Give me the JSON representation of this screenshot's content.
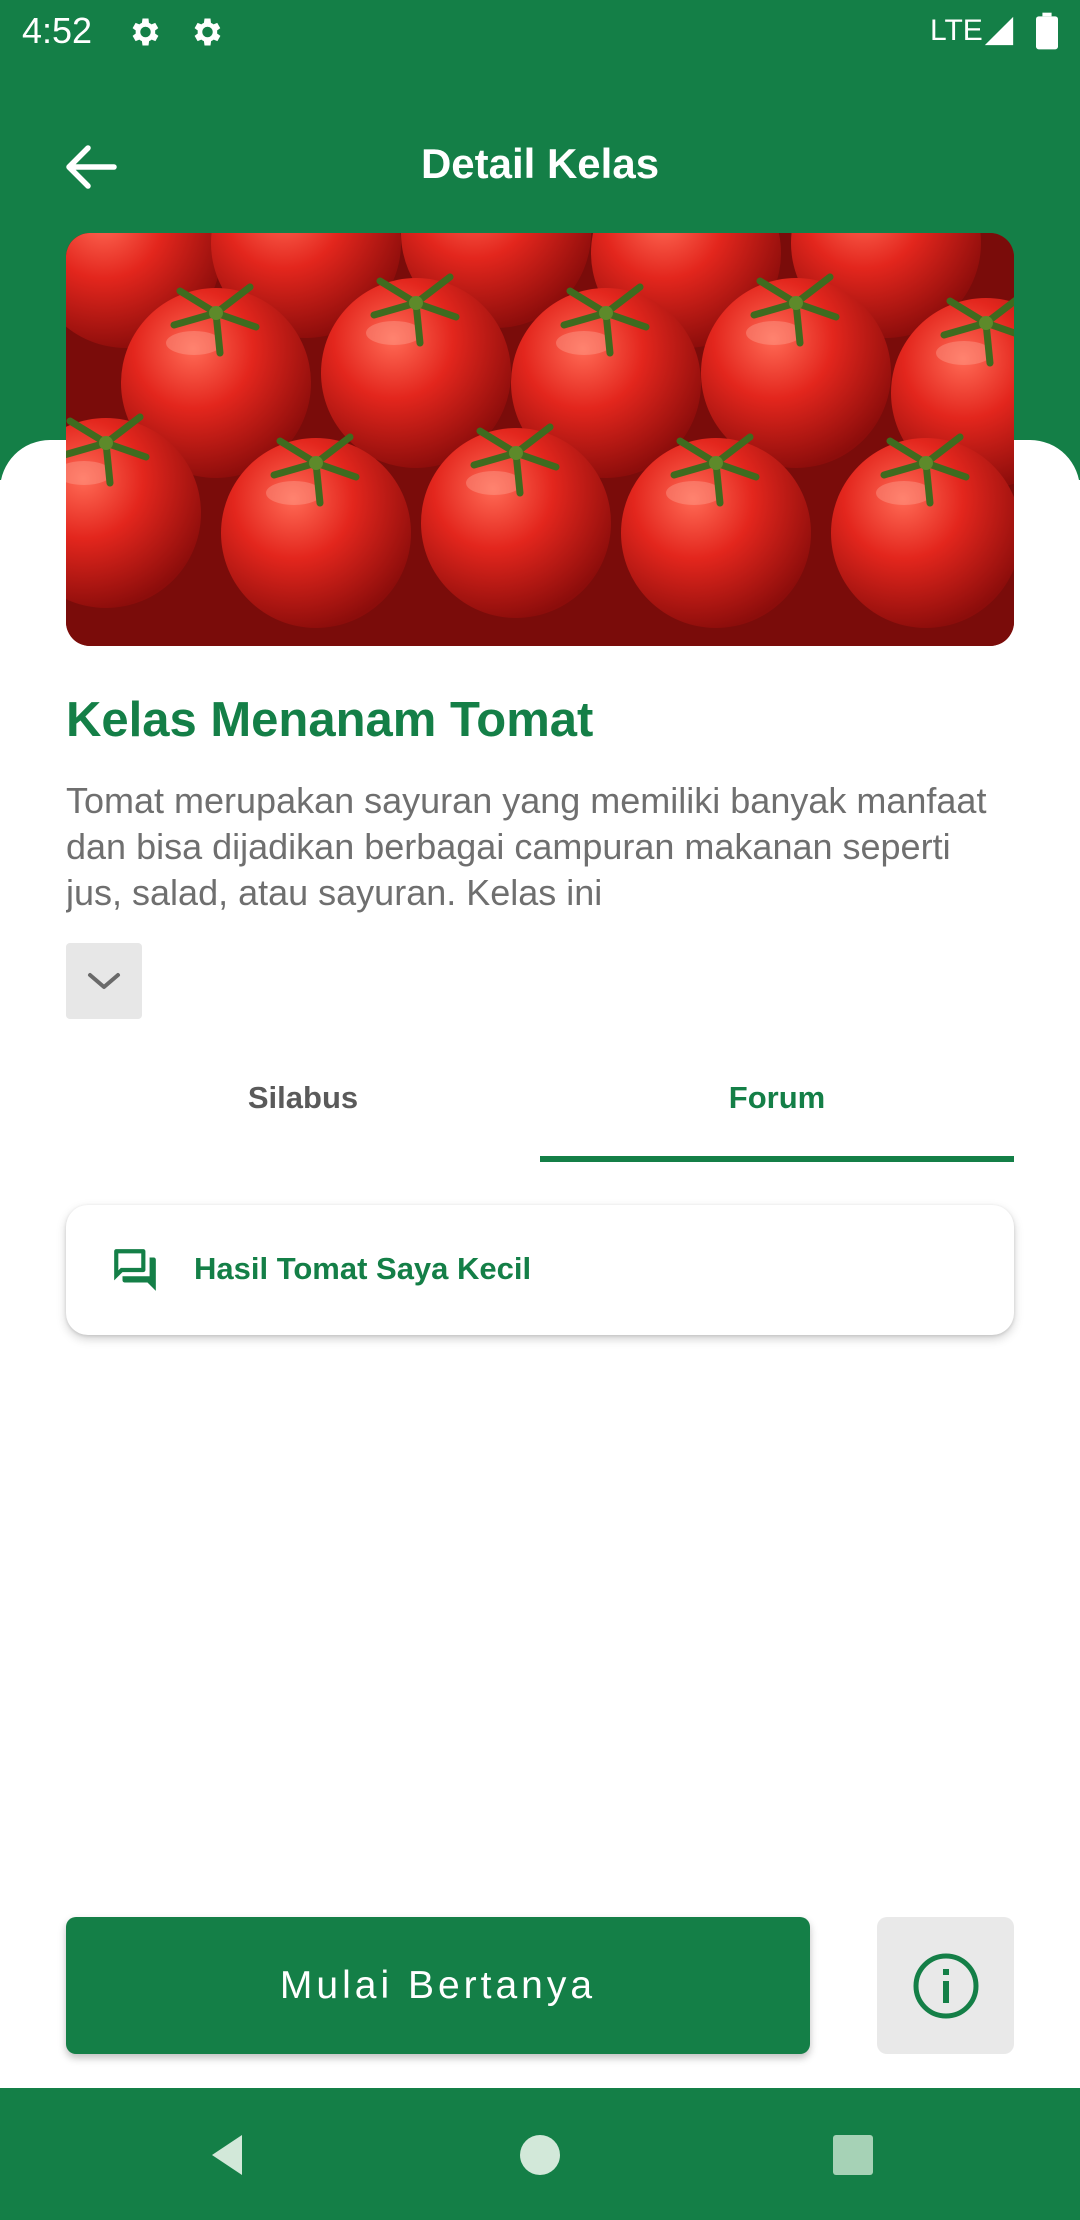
{
  "status_bar": {
    "time": "4:52",
    "network": "LTE",
    "icons": [
      "gear-icon",
      "gear-icon",
      "signal-icon",
      "battery-icon"
    ]
  },
  "app_bar": {
    "title": "Detail Kelas",
    "back_icon": "arrow-left-icon"
  },
  "class": {
    "title": "Kelas Menanam Tomat",
    "description": "Tomat merupakan sayuran yang memiliki banyak manfaat dan bisa dijadikan berbagai campuran makanan seperti jus, salad, atau sayuran. Kelas ini",
    "expand_icon": "chevron-down-icon"
  },
  "tabs": [
    {
      "label": "Silabus",
      "active": false
    },
    {
      "label": "Forum",
      "active": true
    }
  ],
  "forum": {
    "items": [
      {
        "title": "Hasil Tomat Saya Kecil",
        "icon": "forum-icon"
      }
    ]
  },
  "actions": {
    "ask_label": "Mulai Bertanya",
    "info_icon": "info-icon"
  },
  "colors": {
    "primary": "#147f47",
    "text_muted": "#6f6f6f",
    "button_gray": "#e9e9e9"
  }
}
